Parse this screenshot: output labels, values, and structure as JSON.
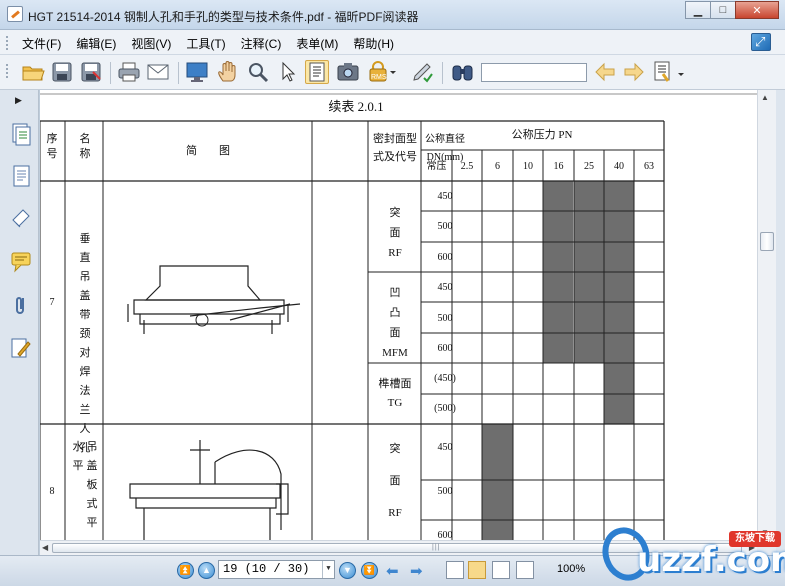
{
  "window": {
    "title": "HGT 21514-2014 钢制人孔和手孔的类型与技术条件.pdf - 福昕PDF阅读器",
    "minimize": "▁",
    "maximize": "□",
    "close": "✕"
  },
  "menu": [
    "文件(F)",
    "编辑(E)",
    "视图(V)",
    "工具(T)",
    "注释(C)",
    "表单(M)",
    "帮助(H)"
  ],
  "toolbar": {
    "search_value": "",
    "icons": [
      "open-folder-icon",
      "save-icon",
      "save-as-icon",
      "print-icon",
      "email-icon",
      "fullscreen-icon",
      "hand-tool-icon",
      "zoom-tool-icon",
      "select-arrow-icon",
      "text-select-icon",
      "snapshot-icon",
      "rms-icon",
      "sign-icon",
      "binoculars-icon",
      "prev-result-icon",
      "next-result-icon",
      "highlight-icon"
    ],
    "rms_label": "RMS"
  },
  "sidebar": {
    "icons": [
      "pages-icon",
      "document-icon",
      "attachments-panel-icon",
      "comments-icon",
      "paperclip-icon",
      "signature-icon"
    ]
  },
  "doc": {
    "table_title": "续表 2.0.1",
    "h_seq": "序号",
    "h_name": "名称",
    "h_diagram": "简　　图",
    "h_seal": "密封面型式及代号",
    "h_dn": "公称直径DN(mm)",
    "h_pn": "公称压力 PN",
    "pn_values": [
      "常压",
      "2.5",
      "6",
      "10",
      "16",
      "25",
      "40",
      "63"
    ],
    "row7": {
      "seq": "7",
      "name": "垂直吊盖带颈对焊法兰人孔"
    },
    "row8": {
      "seq": "8",
      "name": "水平吊盖板式平焊法兰人孔"
    },
    "seal": [
      {
        "label": "突面RF",
        "lines": [
          "突",
          "面",
          "RF"
        ]
      },
      {
        "label": "凹凸面MFM",
        "lines": [
          "凹",
          "凸",
          "面",
          "MFM"
        ]
      },
      {
        "label": "榫槽面TG",
        "lines": [
          "榫槽面",
          "TG"
        ]
      },
      {
        "label": "突面RF",
        "lines": [
          "突",
          "面",
          "RF"
        ]
      }
    ],
    "dn": [
      "450",
      "500",
      "600",
      "450",
      "500",
      "600",
      "(450)",
      "(500)",
      "450",
      "500",
      "600"
    ]
  },
  "status": {
    "page_value": "19 (10 / 30)",
    "zoom": "100%"
  },
  "watermark": {
    "text": "uzzf.com",
    "badge": "东坡下载"
  }
}
